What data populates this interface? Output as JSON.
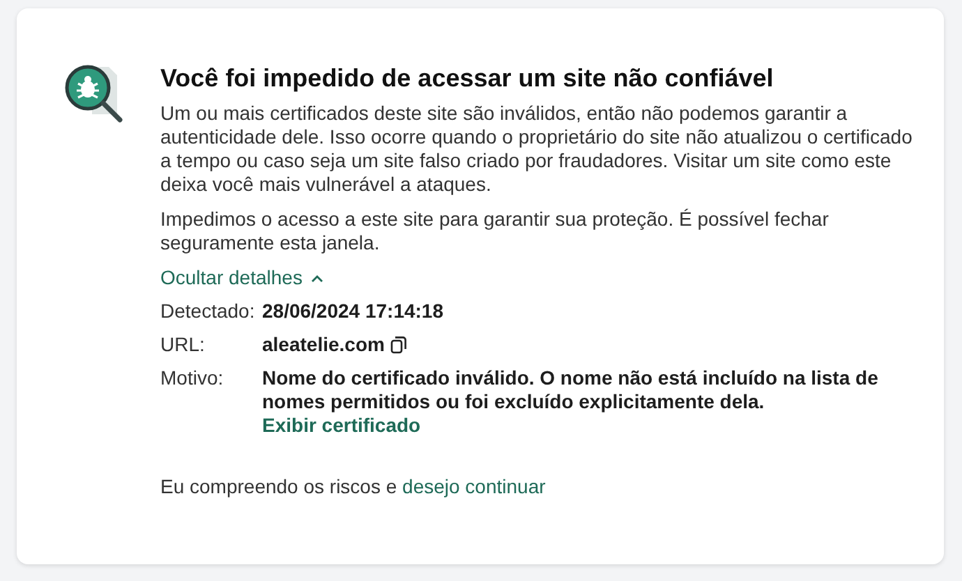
{
  "title": "Você foi impedido de acessar um site não confiável",
  "paragraphs": [
    "Um ou mais certificados deste site são inválidos, então não podemos garantir a autenticidade dele. Isso ocorre quando o proprietário do site não atualizou o certificado a tempo ou caso seja um site falso criado por fraudadores. Visitar um site como este deixa você mais vulnerável a ataques.",
    "Impedimos o acesso a este site para garantir sua proteção. É possível fechar seguramente esta janela."
  ],
  "details_toggle": {
    "label": "Ocultar detalhes",
    "expanded": true
  },
  "details": [
    {
      "label": "Detectado:",
      "value": "28/06/2024 17:14:18",
      "kind": "text"
    },
    {
      "label": "URL:",
      "value": "aleatelie.com",
      "kind": "copy"
    },
    {
      "label": "Motivo:",
      "value": "Nome do certificado inválido. O nome não está incluído na lista de nomes permitidos ou foi excluído explicitamente dela.",
      "kind": "link",
      "link": "Exibir certificado"
    }
  ],
  "footer": {
    "text": "Eu compreendo os riscos e",
    "link": "desejo continuar"
  }
}
